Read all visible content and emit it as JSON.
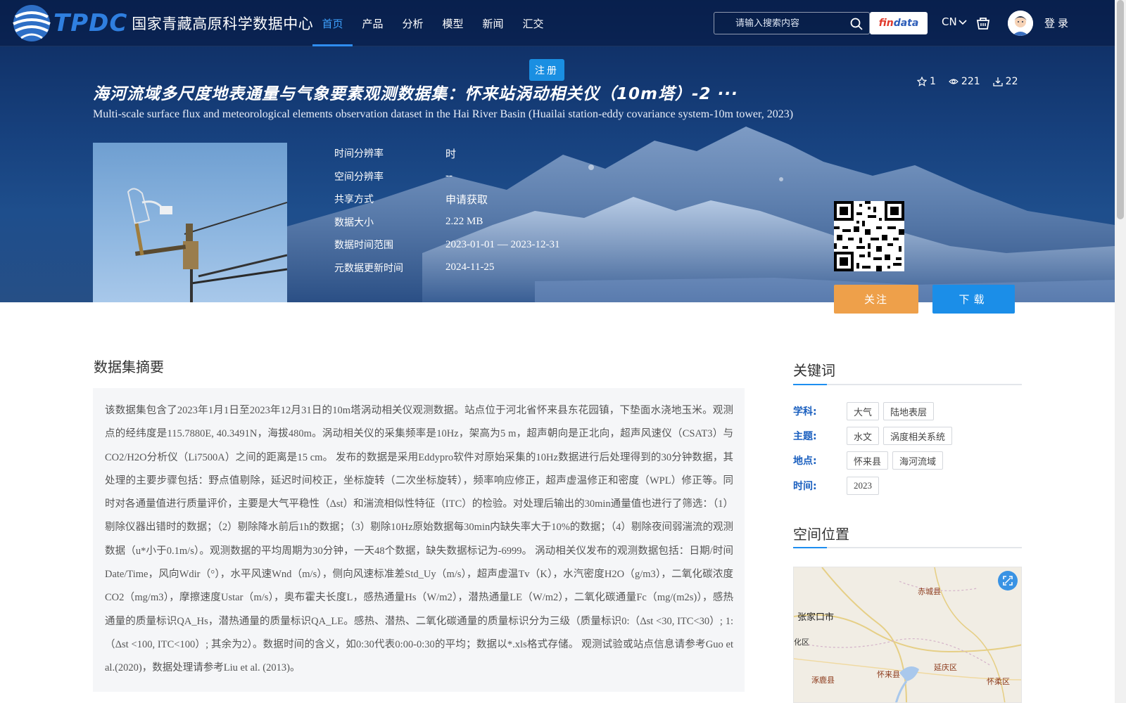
{
  "logo": {
    "abbr": "TPDC",
    "name": "国家青藏高原科学数据中心"
  },
  "nav": [
    {
      "label": "首页",
      "active": true
    },
    {
      "label": "产品",
      "active": false
    },
    {
      "label": "分析",
      "active": false
    },
    {
      "label": "模型",
      "active": false
    },
    {
      "label": "新闻",
      "active": false
    },
    {
      "label": "汇交",
      "active": false
    }
  ],
  "search": {
    "placeholder": "请输入搜索内容"
  },
  "findata": {
    "part1": "fin",
    "part2": "data"
  },
  "lang": "CN",
  "login": "登录",
  "register": "注册",
  "dataset": {
    "title_cn": "海河流域多尺度地表通量与气象要素观测数据集：怀来站涡动相关仪（10m塔）-2 ···",
    "title_en": "Multi-scale surface flux and meteorological elements observation dataset in the Hai River Basin (Huailai station-eddy covariance system-10m tower, 2023)",
    "stats": {
      "stars": "1",
      "views": "221",
      "downloads": "22"
    },
    "meta": [
      {
        "label": "时间分辨率",
        "value": "时"
      },
      {
        "label": "空间分辨率",
        "value": "--"
      },
      {
        "label": "共享方式",
        "value": "申请获取"
      },
      {
        "label": "数据大小",
        "value": "2.22 MB"
      },
      {
        "label": "数据时间范围",
        "value": "2023-01-01 — 2023-12-31"
      },
      {
        "label": "元数据更新时间",
        "value": "2024-11-25"
      }
    ],
    "follow_label": "关注",
    "download_label": "下载"
  },
  "abstract": {
    "title": "数据集摘要",
    "text": "该数据集包含了2023年1月1日至2023年12月31日的10m塔涡动相关仪观测数据。站点位于河北省怀来县东花园镇，下垫面水浇地玉米。观测点的经纬度是115.7880E, 40.3491N，海拔480m。涡动相关仪的采集频率是10Hz，架高为5 m，超声朝向是正北向，超声风速仪（CSAT3）与CO2/H2O分析仪（Li7500A）之间的距离是15 cm。 发布的数据是采用Eddypro软件对原始采集的10Hz数据进行后处理得到的30分钟数据，其处理的主要步骤包括：野点值剔除，延迟时间校正，坐标旋转（二次坐标旋转），频率响应修正，超声虚温修正和密度（WPL）修正等。同时对各通量值进行质量评价，主要是大气平稳性（Δst）和湍流相似性特征（ITC）的检验。对处理后输出的30min通量值也进行了筛选：（1）剔除仪器出错时的数据；（2）剔除降水前后1h的数据；（3）剔除10Hz原始数据每30min内缺失率大于10%的数据；（4）剔除夜间弱湍流的观测数据（u*小于0.1m/s）。观测数据的平均周期为30分钟，一天48个数据，缺失数据标记为-6999。 涡动相关仪发布的观测数据包括：日期/时间Date/Time，风向Wdir（°），水平风速Wnd（m/s），侧向风速标准差Std_Uy（m/s），超声虚温Tv（K），水汽密度H2O（g/m3），二氧化碳浓度CO2（mg/m3），摩擦速度Ustar（m/s），奥布霍夫长度L，感热通量Hs（W/m2），潜热通量LE（W/m2），二氧化碳通量Fc（mg/(m2s)），感热通量的质量标识QA_Hs，潜热通量的质量标识QA_LE。感热、潜热、二氧化碳通量的质量标识分为三级（质量标识0:（Δst <30, ITC<30）; 1:（Δst <100, ITC<100）; 其余为2）。数据时间的含义，如0:30代表0:00-0:30的平均；数据以*.xls格式存储。 观测试验或站点信息请参考Guo et al.(2020)，数据处理请参考Liu et al. (2013)。"
  },
  "keywords": {
    "title": "关键词",
    "rows": [
      {
        "label": "学科:",
        "tags": [
          "大气",
          "陆地表层"
        ]
      },
      {
        "label": "主题:",
        "tags": [
          "水文",
          "涡度相关系统"
        ]
      },
      {
        "label": "地点:",
        "tags": [
          "怀来县",
          "海河流域"
        ]
      },
      {
        "label": "时间:",
        "tags": [
          "2023"
        ]
      }
    ]
  },
  "location": {
    "title": "空间位置",
    "map_labels": [
      "张家口市",
      "赤城县",
      "怀来县",
      "延庆区",
      "涿鹿县",
      "怀柔区",
      "化区"
    ]
  },
  "colors": {
    "accent": "#1b8ee8",
    "follow": "#eea04a",
    "nav_active": "#3ea2ff",
    "keyword_label": "#1a5fbf"
  }
}
